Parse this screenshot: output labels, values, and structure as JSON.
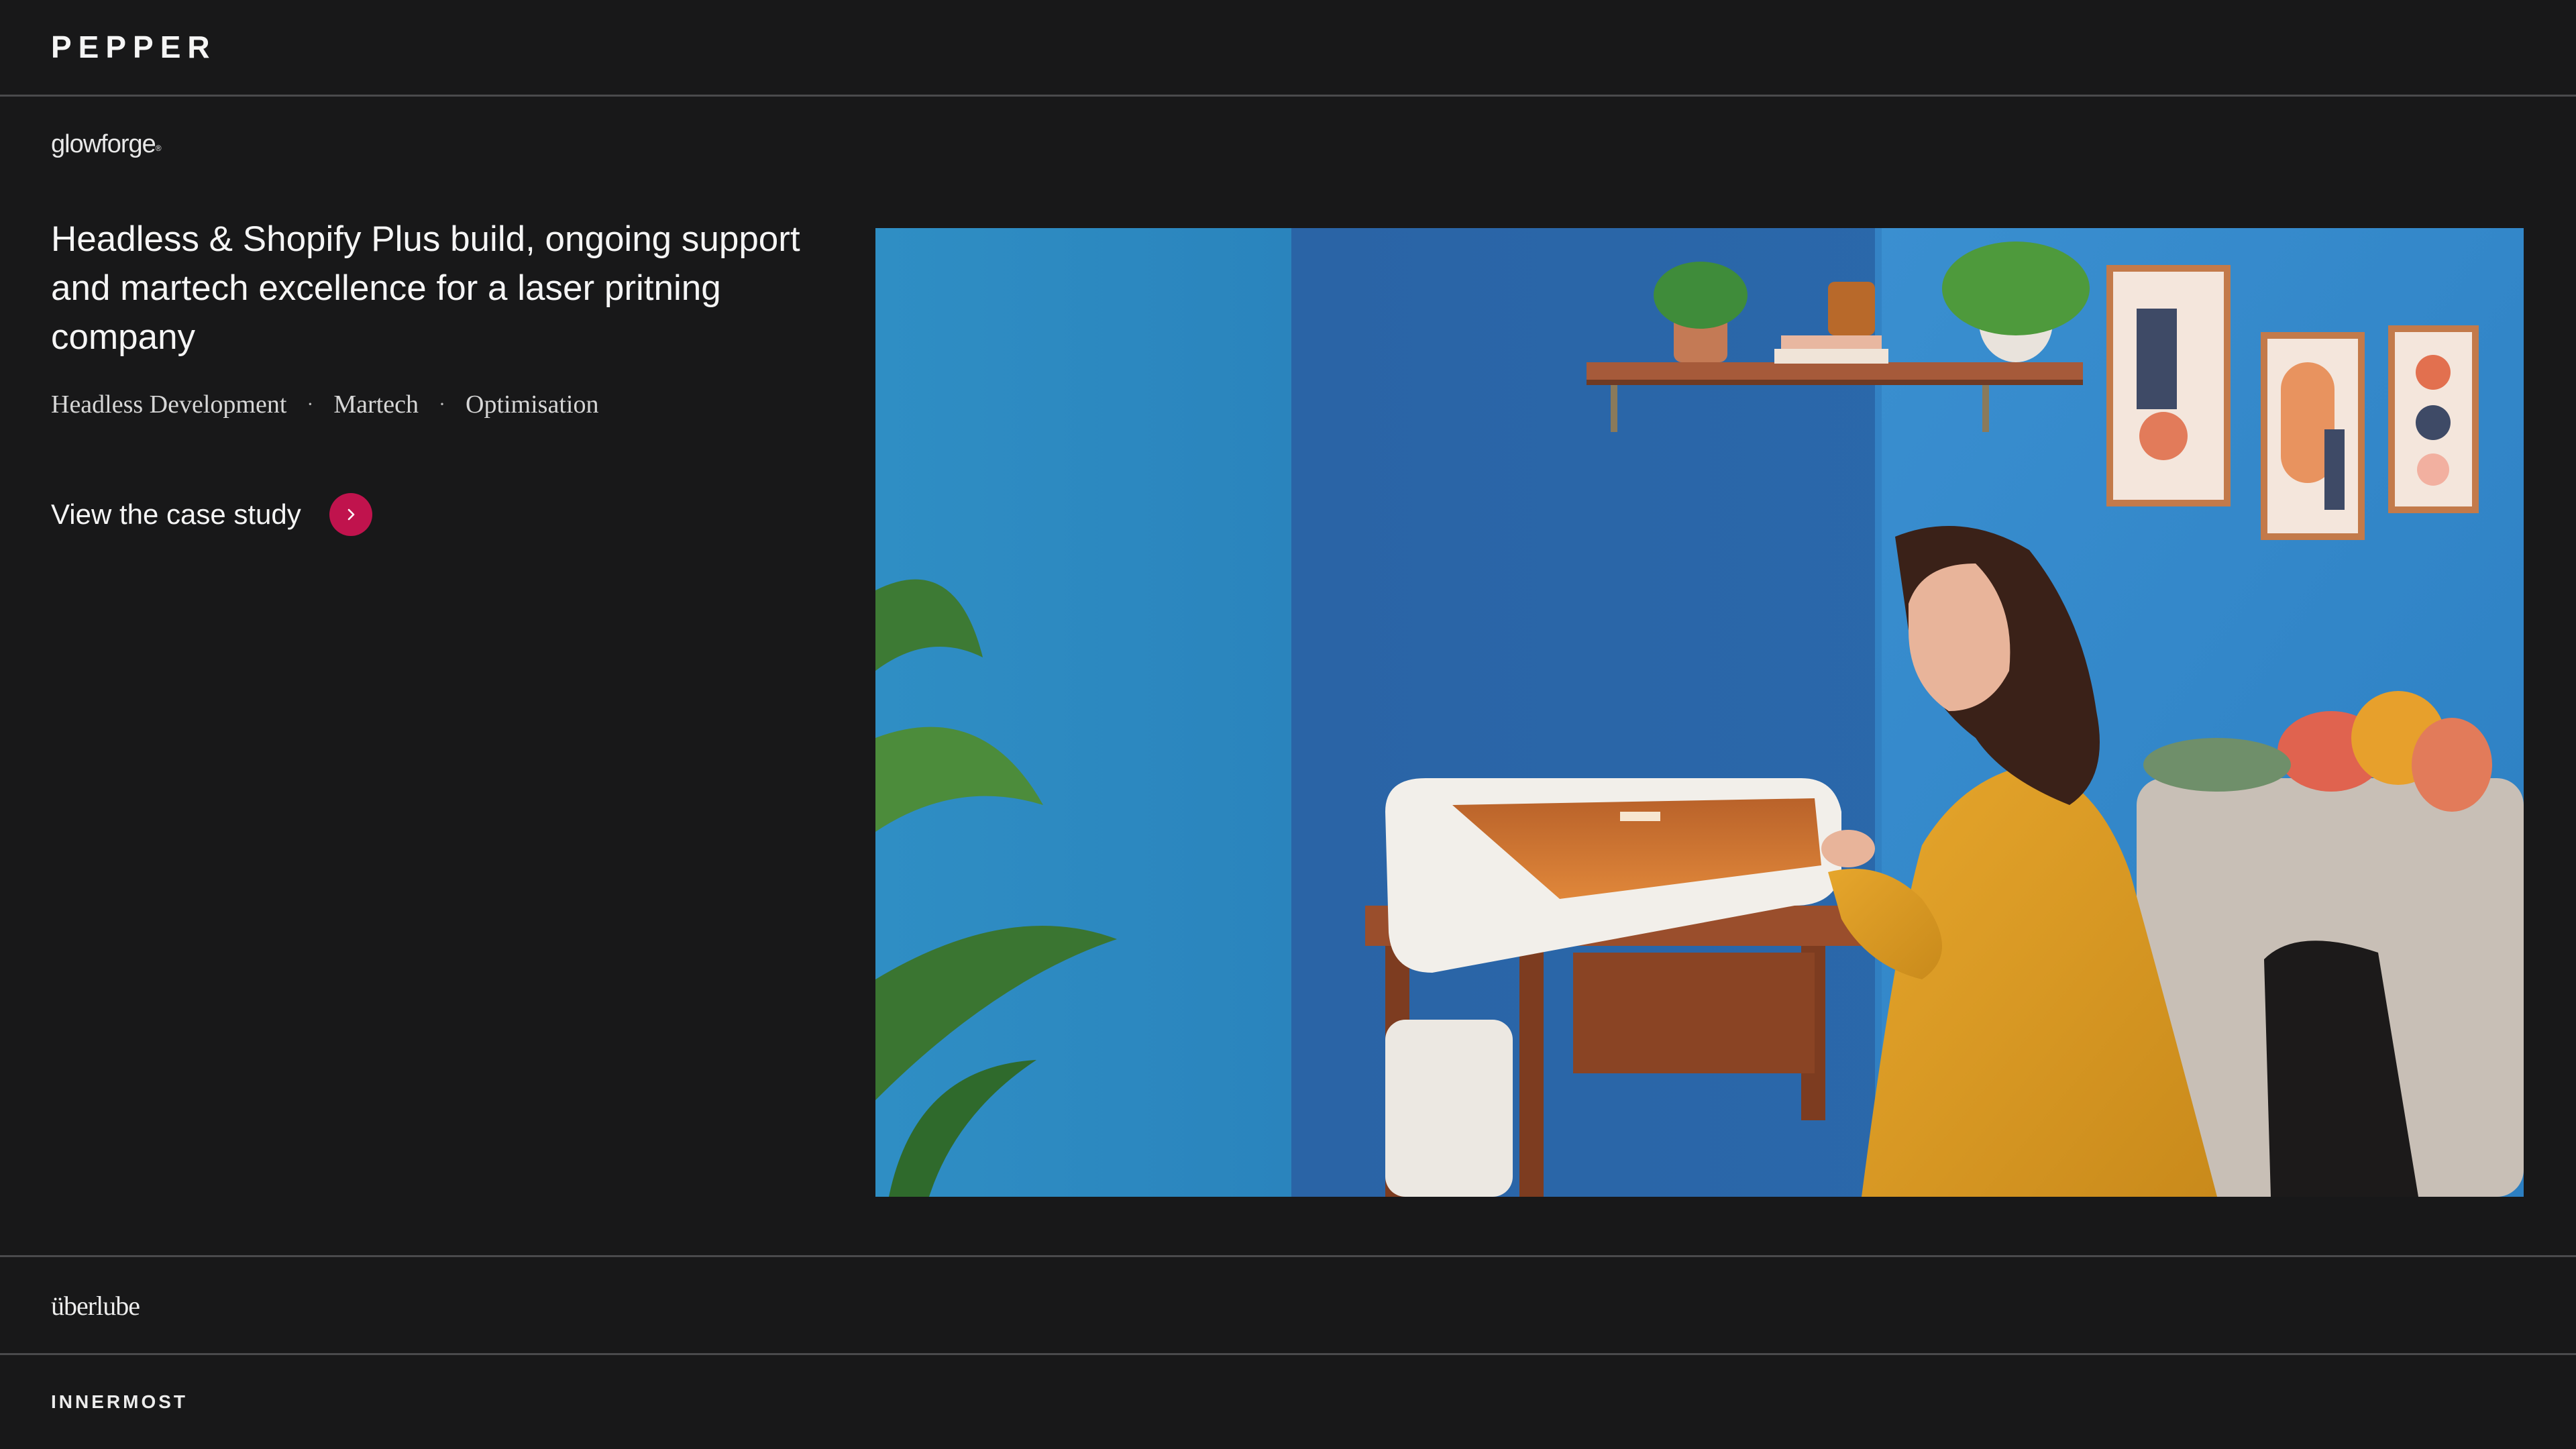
{
  "header": {
    "brand": "PEPPER"
  },
  "project": {
    "client_logo": "glowforge",
    "headline": "Headless & Shopify Plus build, ongoing support and martech excellence for a laser pritning company",
    "tags": [
      "Headless Development",
      "Martech",
      "Optimisation"
    ],
    "tag_separator": "·",
    "cta_label": "View the case study",
    "cta_icon": "chevron-right-icon",
    "accent_color": "#c0134d"
  },
  "hero_image": {
    "subject": "hero-photo"
  },
  "next_projects": [
    {
      "client_logo": "überlube"
    },
    {
      "client_logo": "INNERMOST"
    }
  ]
}
